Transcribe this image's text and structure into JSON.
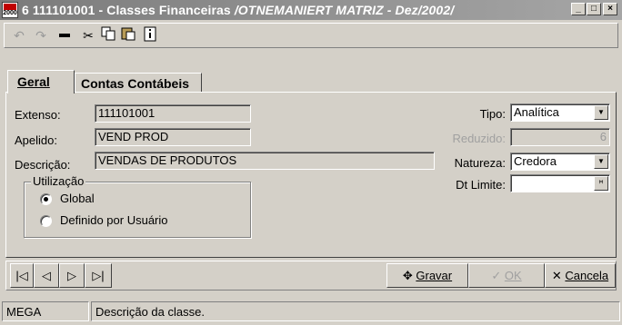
{
  "window": {
    "title": "6 111101001 - Classes Financeiras ",
    "title_context": "/OTNEMANIERT MATRIZ - Dez/2002/",
    "app_icon_text": "2000",
    "controls": {
      "minimize": "_",
      "maximize": "□",
      "close": "×"
    }
  },
  "toolbar": {
    "icons": [
      "undo-icon",
      "redo-icon",
      "minus-icon",
      "cut-icon",
      "copy-icon",
      "paste-icon",
      "info-icon"
    ]
  },
  "tabs": [
    {
      "label": "Geral",
      "active": true
    },
    {
      "label": "Contas Contábeis",
      "active": false
    }
  ],
  "form": {
    "extenso": {
      "label": "Extenso:",
      "value": "111101001"
    },
    "apelido": {
      "label": "Apelido:",
      "value": "VEND PROD"
    },
    "descricao": {
      "label": "Descrição:",
      "value": "VENDAS DE PRODUTOS"
    },
    "tipo": {
      "label": "Tipo:",
      "value": "Analítica"
    },
    "reduzido": {
      "label": "Reduzido:",
      "value": "6"
    },
    "natureza": {
      "label": "Natureza:",
      "value": "Credora"
    },
    "dt_limite": {
      "label": "Dt Limite:",
      "value": "",
      "button": "ꟸ"
    },
    "utilizacao": {
      "title": "Utilização",
      "options": [
        {
          "label": "Global",
          "selected": true
        },
        {
          "label": "Definido por Usuário",
          "selected": false
        }
      ]
    }
  },
  "navigator": {
    "first": "|◁",
    "prev": "◁",
    "next": "▷",
    "last": "▷|",
    "save": {
      "icon": "✥",
      "label": "Gravar"
    },
    "ok": {
      "icon": "✓",
      "label": "OK"
    },
    "cancel": {
      "icon": "✕",
      "label": "Cancela"
    }
  },
  "statusbar": {
    "company": "MEGA",
    "message": "Descrição da classe."
  }
}
